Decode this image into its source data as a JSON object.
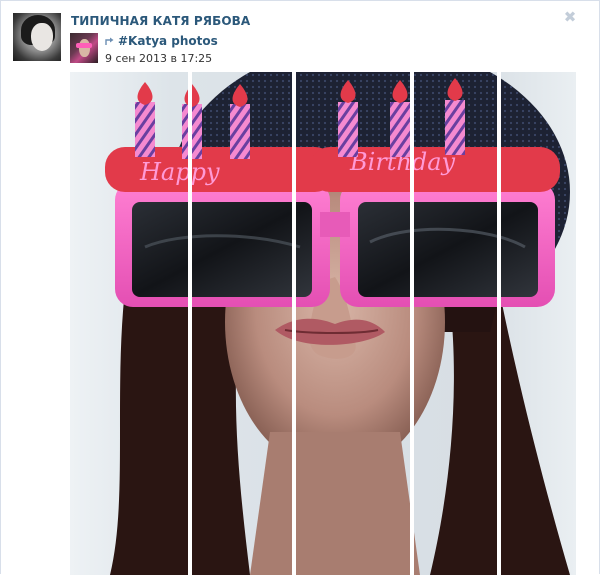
{
  "post": {
    "author_name": "ТИПИЧНАЯ КАТЯ РЯБОВА",
    "repost_source": "#Katya photos",
    "date": "9 сен 2013 в 17:25",
    "close_glyph": "✖"
  },
  "photo": {
    "glasses_text_left": "Happy",
    "glasses_text_right": "Birthday"
  },
  "colors": {
    "link": "#2b587a",
    "border": "#d8dfea",
    "pink": "#f56cc8",
    "candle_red": "#e23a4a"
  },
  "icons": {
    "close": "close-icon",
    "repost": "repost-arrow-icon"
  }
}
